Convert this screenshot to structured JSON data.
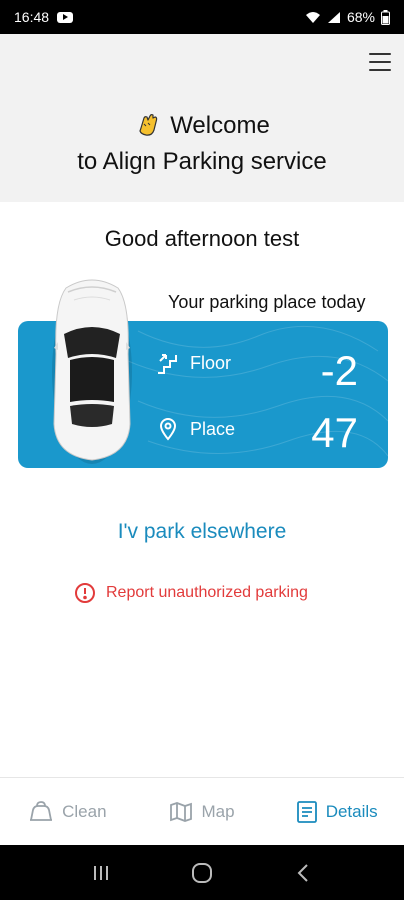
{
  "status_bar": {
    "time": "16:48",
    "battery": "68%"
  },
  "header": {
    "welcome_line1": "Welcome",
    "welcome_line2": "to Align Parking service"
  },
  "greeting": "Good afternoon test",
  "parking": {
    "today_label": "Your parking place today",
    "floor_label": "Floor",
    "floor_value": "-2",
    "place_label": "Place",
    "place_value": "47"
  },
  "links": {
    "elsewhere": "I'v park elsewhere",
    "report": "Report unauthorized parking"
  },
  "bottom_nav": [
    {
      "label": "Clean",
      "icon": "clean-icon",
      "active": false
    },
    {
      "label": "Map",
      "icon": "map-icon",
      "active": false
    },
    {
      "label": "Details",
      "icon": "details-icon",
      "active": true
    }
  ],
  "colors": {
    "accent": "#1a98cc",
    "link": "#1a8bbd",
    "danger": "#e23b3b",
    "header_bg": "#f2f2f2"
  }
}
